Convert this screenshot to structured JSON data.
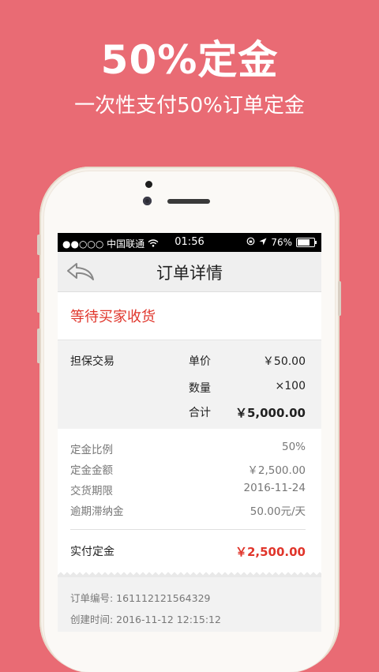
{
  "headline": "50%定金",
  "subheadline": "一次性支付50%订单定金",
  "statusbar": {
    "carrier": "●●○○○ 中国联通",
    "time": "01:56",
    "battery": "76%",
    "battery_level": 0.76
  },
  "navbar": {
    "title": "订单详情",
    "back_icon": "back-arrow-icon"
  },
  "order_status": "等待买家收货",
  "product": {
    "type": "担保交易",
    "unit_price_label": "单价",
    "unit_price": "￥50.00",
    "quantity_label": "数量",
    "quantity": "×100",
    "total_label": "合计",
    "total": "￥5,000.00"
  },
  "deposit": {
    "ratio_label": "定金比例",
    "ratio": "50%",
    "amount_label": "定金金额",
    "amount": "￥2,500.00",
    "deadline_label": "交货期限",
    "deadline": "2016-11-24",
    "penalty_label": "逾期滞纳金",
    "penalty": "50.00元/天",
    "paid_label": "实付定金",
    "paid": "￥2,500.00"
  },
  "order_meta": {
    "number": "订单编号:  161112121564329",
    "created": "创建时间:  2016-11-12 12:15:12"
  },
  "colors": {
    "background": "#e96b74",
    "accent_red": "#e0352b"
  }
}
